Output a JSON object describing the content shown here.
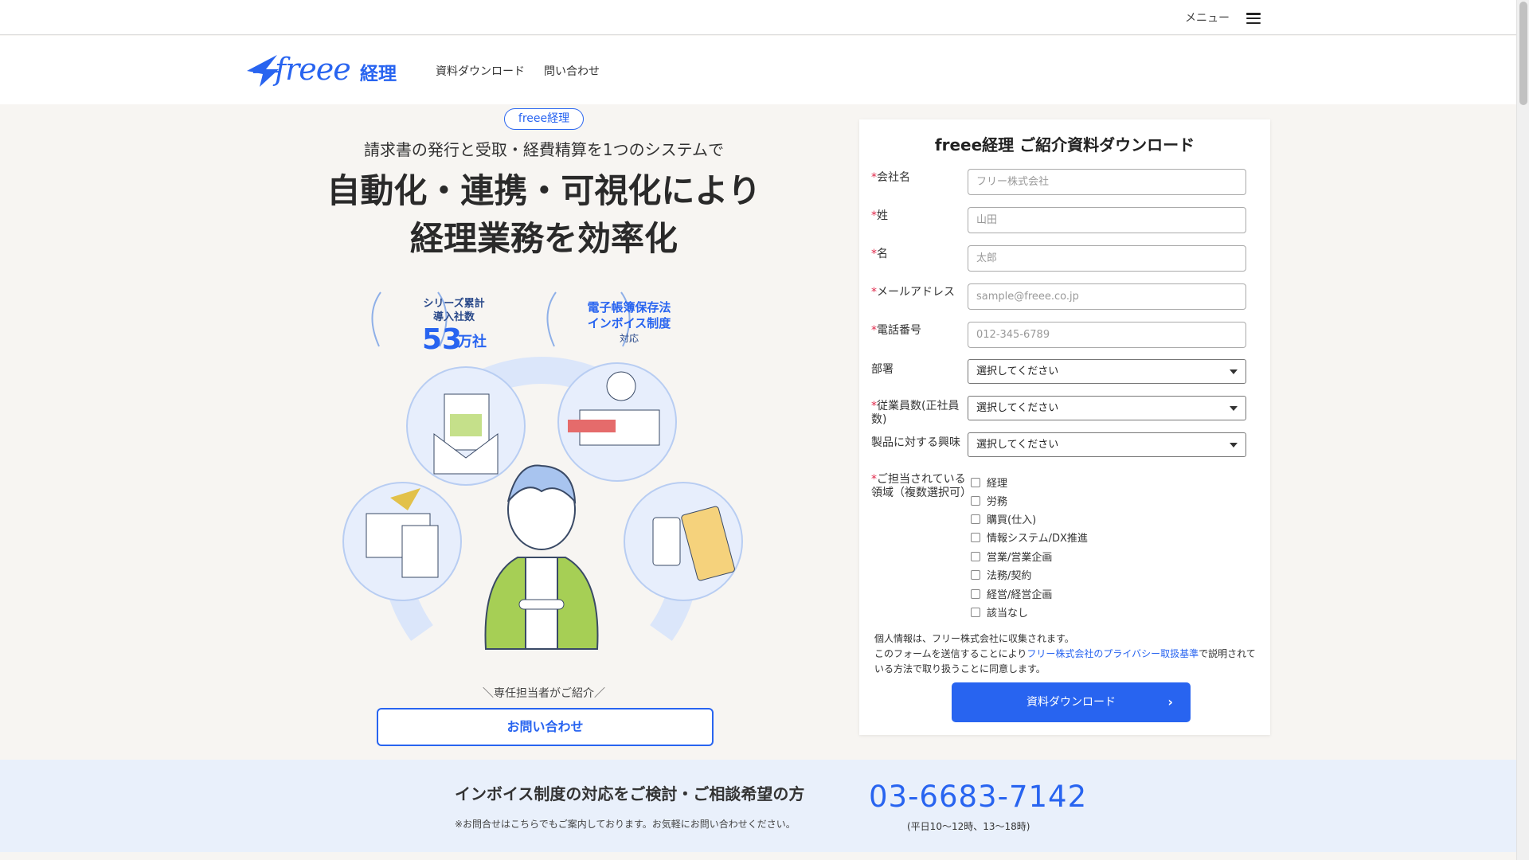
{
  "topbar": {
    "menu_label": "メニュー"
  },
  "header": {
    "logo_text": "freee",
    "logo_ja": "経理",
    "nav": [
      "資料ダウンロード",
      "問い合わせ"
    ]
  },
  "hero": {
    "badge": "freee経理",
    "subtitle": "請求書の発行と受取・経費精算を1つのシステムで",
    "title_line1": "自動化・連携・可視化により",
    "title_line2": "経理業務を効率化",
    "award1_line1": "シリーズ累計",
    "award1_line2": "導入社数",
    "award1_number": "53",
    "award1_unit": "万社",
    "award2_line1": "電子帳簿保存法",
    "award2_line2": "インボイス制度",
    "award2_line3": "対応",
    "contact_caption": "＼専任担当者がご紹介／",
    "contact_button": "お問い合わせ"
  },
  "form": {
    "title": "freee経理 ご紹介資料ダウンロード",
    "required_mark": "*",
    "company_label": "会社名",
    "company_placeholder": "フリー株式会社",
    "last_name_label": "姓",
    "last_name_placeholder": "山田",
    "first_name_label": "名",
    "first_name_placeholder": "太郎",
    "email_label": "メールアドレス",
    "email_placeholder": "sample@freee.co.jp",
    "phone_label": "電話番号",
    "phone_placeholder": "012-345-6789",
    "department_label": "部署",
    "department_value": "選択してください",
    "employees_label": "従業員数(正社員数)",
    "employees_value": "選択してください",
    "interest_label": "製品に対する興味",
    "interest_value": "選択してください",
    "areas_label": "ご担当されている領域（複数選択可）",
    "areas": [
      "経理",
      "労務",
      "購買(仕入)",
      "情報システム/DX推進",
      "営業/営業企画",
      "法務/契約",
      "経営/経営企画",
      "該当なし"
    ],
    "privacy_text1": "個人情報は、フリー株式会社に収集されます。",
    "privacy_text2": "このフォームを送信することにより",
    "privacy_link": "フリー株式会社のプライバシー取扱基準",
    "privacy_text3": "で説明されている方法で取り扱うことに同意します。",
    "submit_label": "資料ダウンロード"
  },
  "band": {
    "title": "インボイス制度の対応をご検討・ご相談希望の方",
    "note": "※お問合せはこちらでもご案内しております。お気軽にお問い合わせください。",
    "phone": "03-6683-7142",
    "hours": "(平日10〜12時、13〜18時)"
  },
  "colors": {
    "brand": "#2864f0",
    "required": "#e0284a",
    "band_bg": "#e9f0fb"
  }
}
